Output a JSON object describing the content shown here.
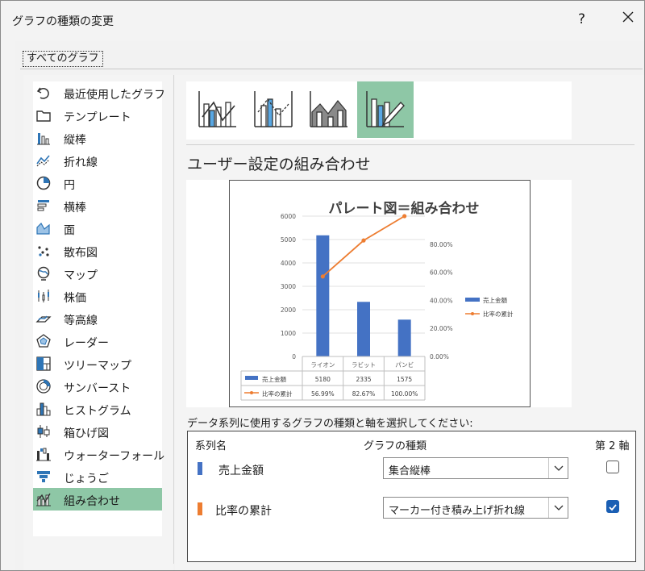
{
  "window": {
    "title": "グラフの種類の変更",
    "help": "?"
  },
  "tabs": {
    "all_charts": "すべてのグラフ"
  },
  "chart_types": [
    {
      "label": "最近使用したグラフ",
      "icon": "recent-icon"
    },
    {
      "label": "テンプレート",
      "icon": "folder-icon"
    },
    {
      "label": "縦棒",
      "icon": "column-chart-icon"
    },
    {
      "label": "折れ線",
      "icon": "line-chart-icon"
    },
    {
      "label": "円",
      "icon": "pie-chart-icon"
    },
    {
      "label": "横棒",
      "icon": "bar-chart-icon"
    },
    {
      "label": "面",
      "icon": "area-chart-icon"
    },
    {
      "label": "散布図",
      "icon": "scatter-chart-icon"
    },
    {
      "label": "マップ",
      "icon": "map-chart-icon"
    },
    {
      "label": "株価",
      "icon": "stock-chart-icon"
    },
    {
      "label": "等高線",
      "icon": "surface-chart-icon"
    },
    {
      "label": "レーダー",
      "icon": "radar-chart-icon"
    },
    {
      "label": "ツリーマップ",
      "icon": "treemap-icon"
    },
    {
      "label": "サンバースト",
      "icon": "sunburst-icon"
    },
    {
      "label": "ヒストグラム",
      "icon": "histogram-icon"
    },
    {
      "label": "箱ひげ図",
      "icon": "box-whisker-icon"
    },
    {
      "label": "ウォーターフォール",
      "icon": "waterfall-icon"
    },
    {
      "label": "じょうご",
      "icon": "funnel-icon"
    },
    {
      "label": "組み合わせ",
      "icon": "combo-chart-icon"
    }
  ],
  "selected_type": "組み合わせ",
  "section_title": "ユーザー設定の組み合わせ",
  "instruction": "データ系列に使用するグラフの種類と軸を選択してください:",
  "table": {
    "headers": {
      "series": "系列名",
      "chart_type": "グラフの種類",
      "secondary": "第 2 軸"
    },
    "rows": [
      {
        "name": "売上金額",
        "color": "#4472c4",
        "type": "集合縦棒",
        "secondary_axis": false
      },
      {
        "name": "比率の累計",
        "color": "#ed7d31",
        "type": "マーカー付き積み上げ折れ線",
        "secondary_axis": true
      }
    ]
  },
  "colors": {
    "selected_bg": "#8ec7a6",
    "bar": "#4472c4",
    "line": "#ed7d31",
    "checkbox": "#1a5fb4"
  },
  "chart_data": {
    "type": "bar",
    "title": "パレート図＝組み合わせ",
    "categories": [
      "ライオン",
      "ラビット",
      "パンビ"
    ],
    "series": [
      {
        "name": "売上金額",
        "type": "bar",
        "axis": "primary",
        "values": [
          5180,
          2335,
          1575
        ],
        "labels": [
          "5180",
          "2335",
          "1575"
        ]
      },
      {
        "name": "比率の累計",
        "type": "line",
        "axis": "secondary",
        "values": [
          56.99,
          82.67,
          100.0
        ],
        "labels": [
          "56.99%",
          "82.67%",
          "100.00%"
        ]
      }
    ],
    "primary_axis": {
      "min": 0,
      "max": 6000,
      "ticks": [
        "0",
        "1000",
        "2000",
        "3000",
        "4000",
        "5000",
        "6000"
      ]
    },
    "secondary_axis": {
      "min": 0,
      "max": 100,
      "ticks": [
        "0.00%",
        "20.00%",
        "40.00%",
        "60.00%",
        "80.00%"
      ]
    },
    "legend": "right",
    "data_table": true
  }
}
